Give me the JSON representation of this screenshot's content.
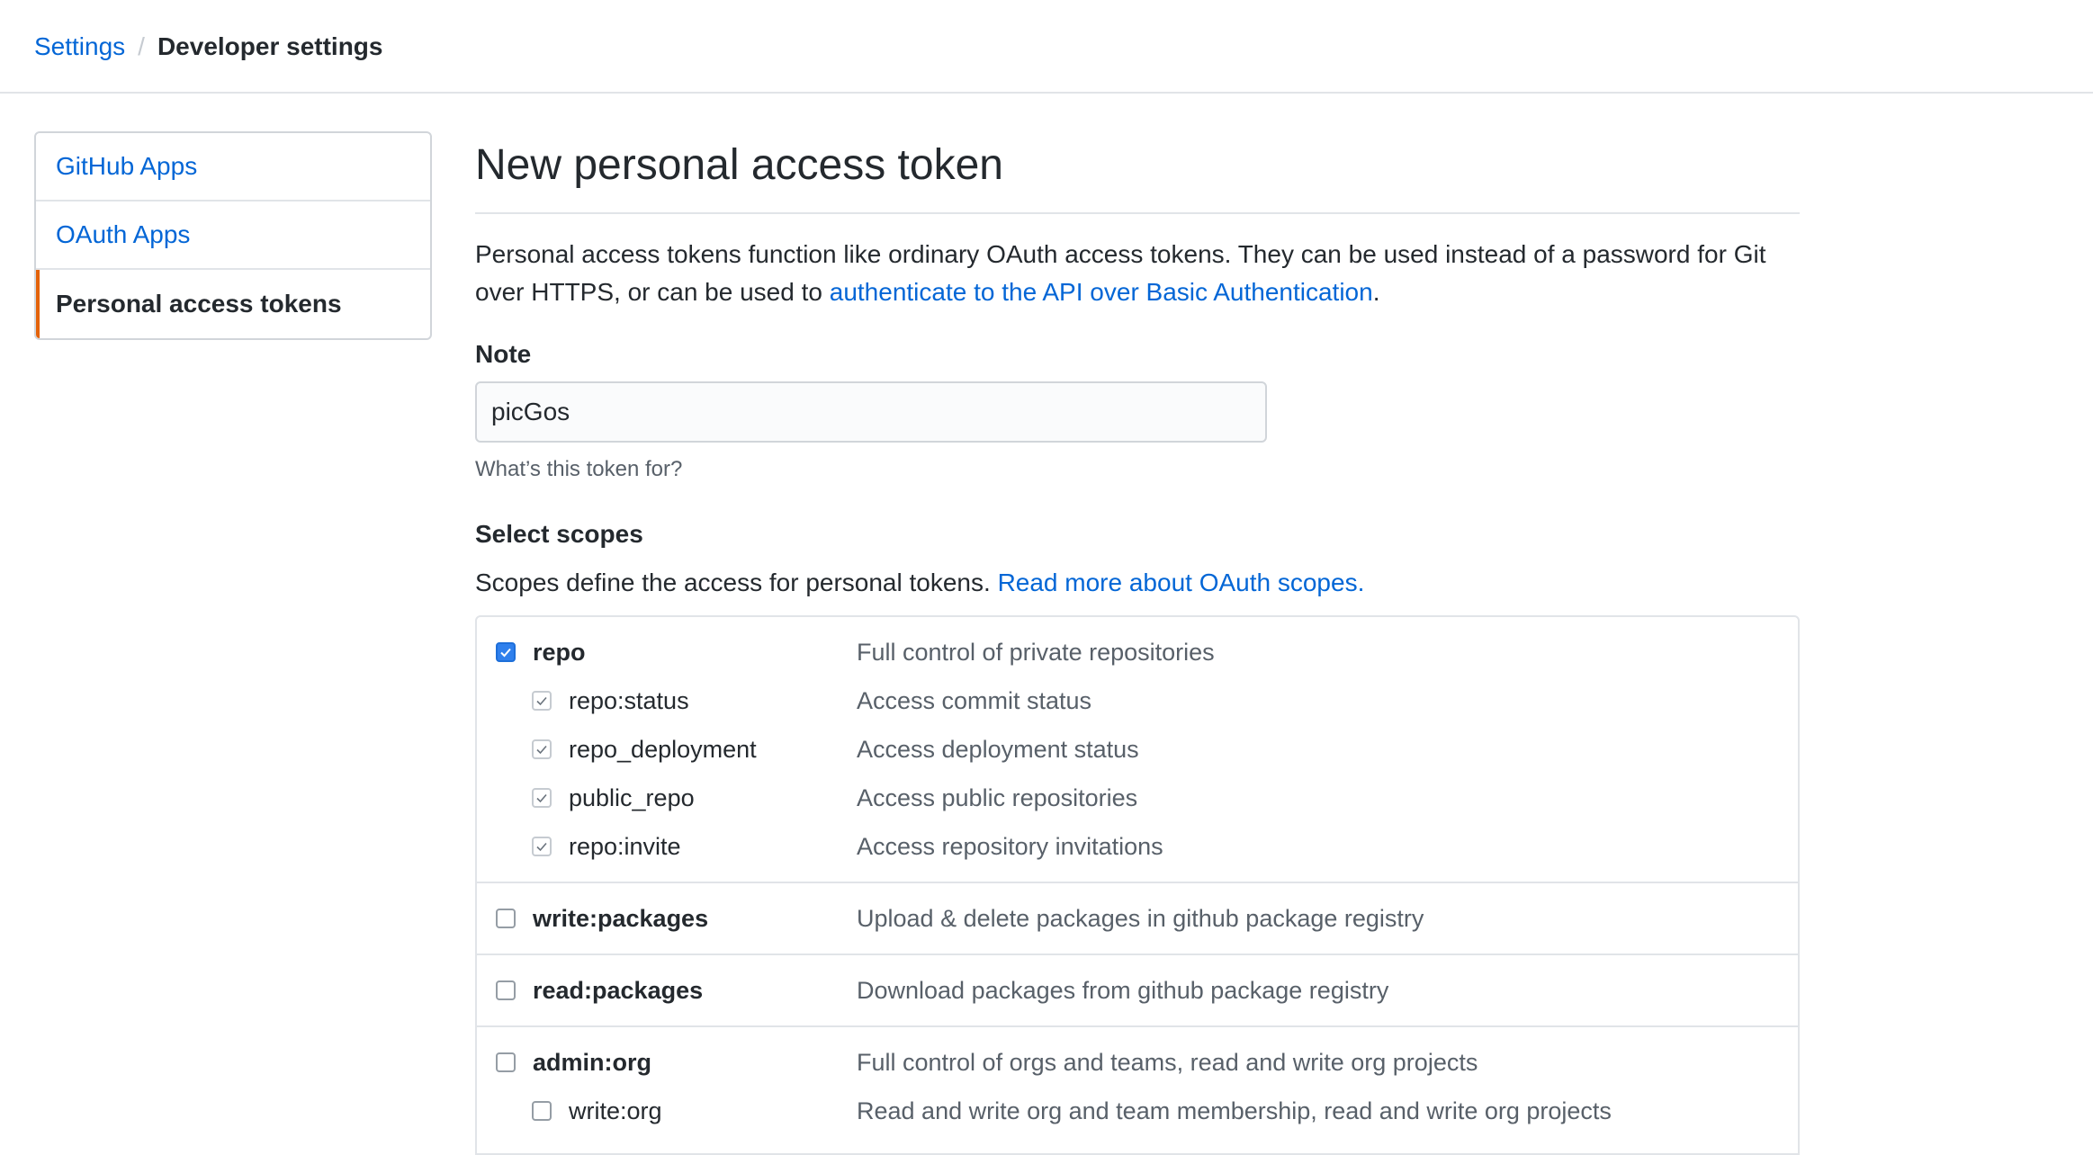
{
  "breadcrumb": {
    "parent": "Settings",
    "separator": "/",
    "current": "Developer settings"
  },
  "sidebar": {
    "items": [
      {
        "label": "GitHub Apps"
      },
      {
        "label": "OAuth Apps"
      },
      {
        "label": "Personal access tokens"
      }
    ],
    "selected": "Personal access tokens",
    "accent_color": "#e36209"
  },
  "main": {
    "title": "New personal access token",
    "intro_text": "Personal access tokens function like ordinary OAuth access tokens. They can be used instead of a password for Git over HTTPS, or can be used to ",
    "intro_link": "authenticate to the API over Basic Authentication",
    "intro_end": ".",
    "note": {
      "label": "Note",
      "value": "picGos",
      "hint": "What’s this token for?"
    },
    "scopes": {
      "title": "Select scopes",
      "desc": "Scopes define the access for personal tokens. ",
      "desc_link": "Read more about OAuth scopes.",
      "groups": [
        {
          "name": "repo",
          "desc": "Full control of private repositories",
          "checked": true,
          "children": [
            {
              "name": "repo:status",
              "desc": "Access commit status",
              "checked": true
            },
            {
              "name": "repo_deployment",
              "desc": "Access deployment status",
              "checked": true
            },
            {
              "name": "public_repo",
              "desc": "Access public repositories",
              "checked": true
            },
            {
              "name": "repo:invite",
              "desc": "Access repository invitations",
              "checked": true
            }
          ]
        },
        {
          "name": "write:packages",
          "desc": "Upload & delete packages in github package registry",
          "checked": false,
          "children": []
        },
        {
          "name": "read:packages",
          "desc": "Download packages from github package registry",
          "checked": false,
          "children": []
        },
        {
          "name": "admin:org",
          "desc": "Full control of orgs and teams, read and write org projects",
          "checked": false,
          "children": [
            {
              "name": "write:org",
              "desc": "Read and write org and team membership, read and write org projects",
              "checked": false
            }
          ]
        }
      ]
    }
  },
  "colors": {
    "link": "#0366d6",
    "checkbox_checked": "#2f80ed"
  }
}
